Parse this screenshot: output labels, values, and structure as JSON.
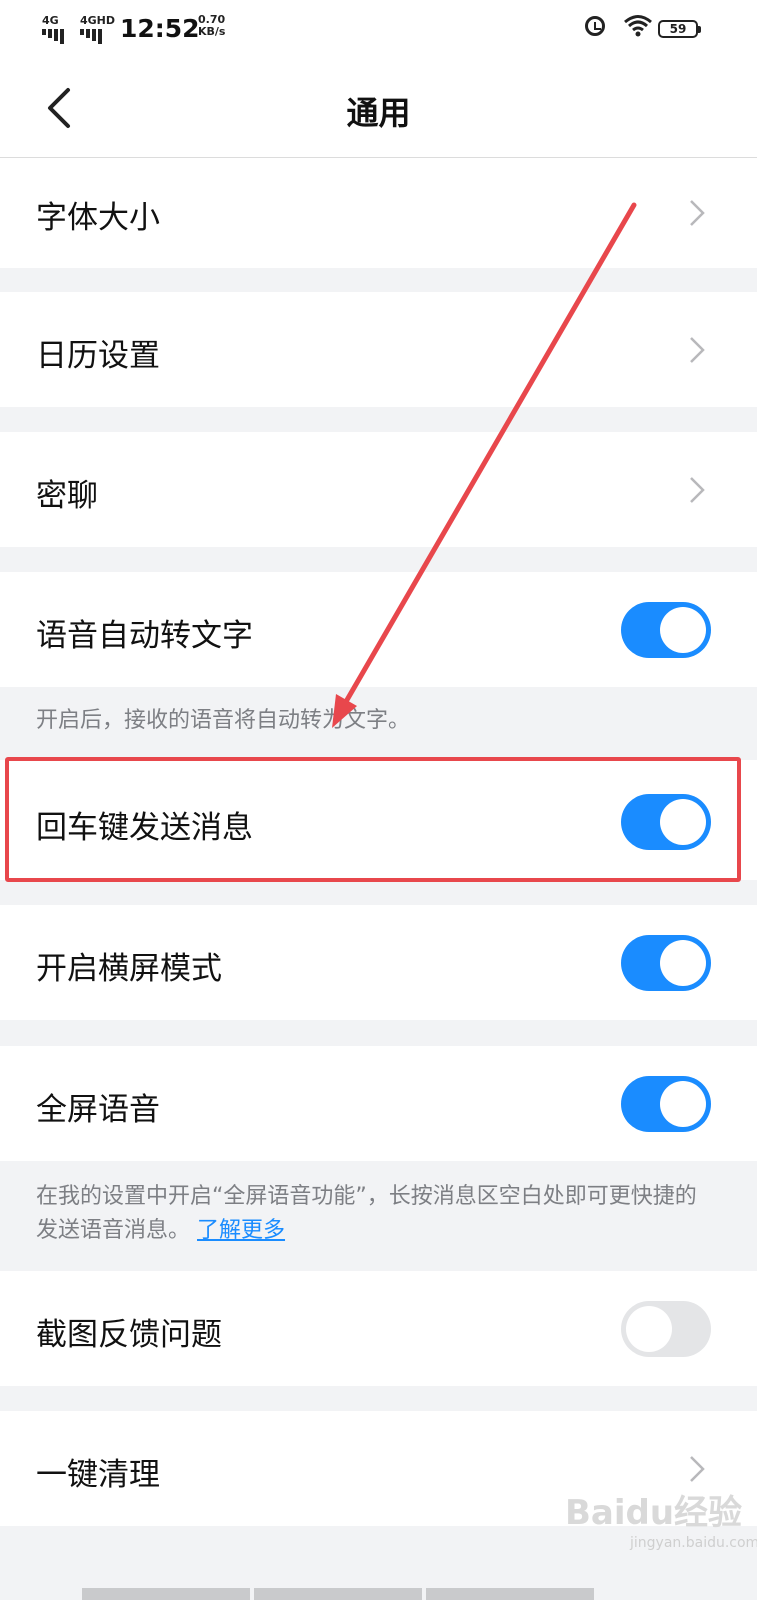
{
  "status_bar": {
    "signal1": "4G",
    "signal2": "4GHD",
    "time": "12:52",
    "speed_value": "0.70",
    "speed_unit": "KB/s",
    "battery": "59"
  },
  "header": {
    "title": "通用"
  },
  "settings": {
    "font_size": "字体大小",
    "calendar": "日历设置",
    "secret_chat": "密聊",
    "voice_to_text": "语音自动转文字",
    "voice_to_text_note": "开启后，接收的语音将自动转为文字。",
    "enter_to_send": "回车键发送消息",
    "landscape": "开启横屏模式",
    "fullscreen_voice": "全屏语音",
    "fullscreen_voice_note": "在我的设置中开启“全屏语音功能”，长按消息区空白处即可更快捷的发送语音消息。",
    "learn_more": "了解更多",
    "screenshot_feedback": "截图反馈问题",
    "one_key_clean": "一键清理"
  },
  "toggles": {
    "voice_to_text": true,
    "enter_to_send": true,
    "landscape": true,
    "fullscreen_voice": true,
    "screenshot_feedback": false
  },
  "watermark": {
    "text": "Baidu经验",
    "sub": "jingyan.baidu.com"
  },
  "colors": {
    "accent": "#1a8cff",
    "highlight": "#e8474c"
  }
}
